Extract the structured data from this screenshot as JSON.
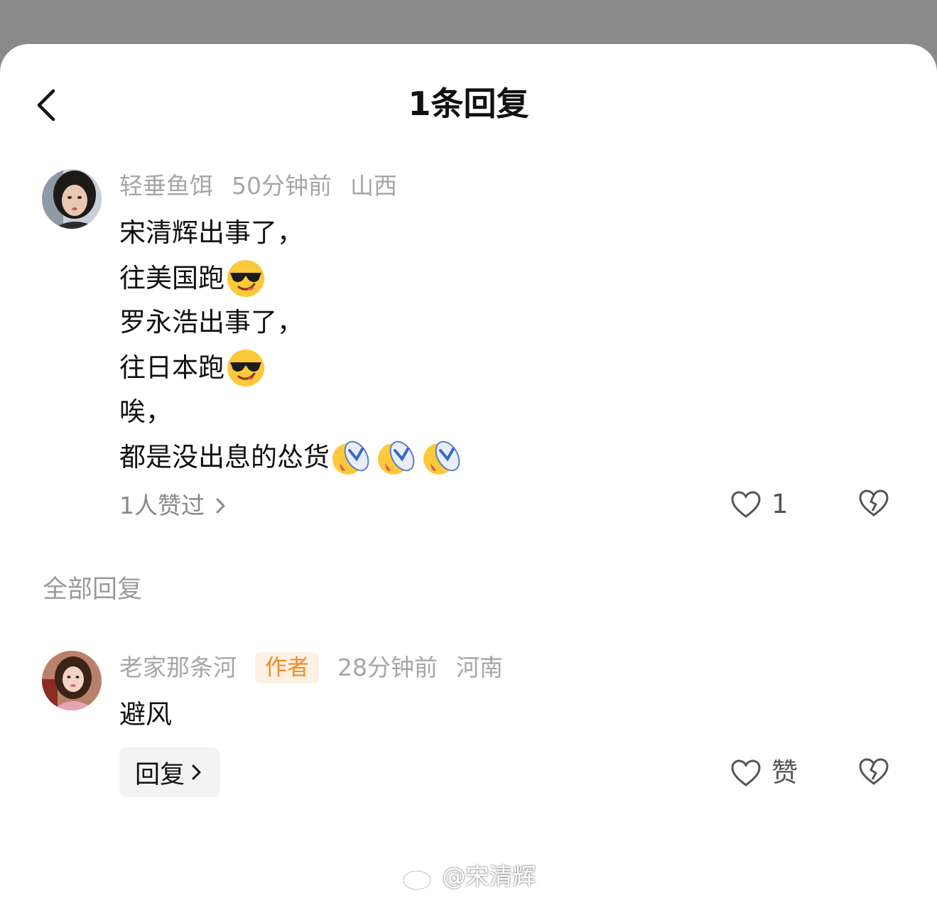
{
  "header": {
    "title": "1条回复"
  },
  "comment": {
    "username": "轻垂鱼饵",
    "time": "50分钟前",
    "location": "山西",
    "lines": [
      "宋清辉出事了，",
      "往美国跑",
      "罗永浩出事了，",
      "往日本跑",
      "唉，",
      "都是没出息的怂货"
    ],
    "emojis": {
      "line2": "cool-sunglasses-emoji",
      "line4": "cool-sunglasses-emoji",
      "line6": "crying-slipper-emoji"
    },
    "likes_text": "1人赞过",
    "like_count": "1"
  },
  "section": {
    "label": "全部回复"
  },
  "reply": {
    "username": "老家那条河",
    "badge": "作者",
    "time": "28分钟前",
    "location": "河南",
    "text": "避风",
    "reply_button": "回复",
    "like_label": "赞"
  },
  "watermark": {
    "text": "@宋清辉"
  },
  "colors": {
    "overlay": "#8a8a8a",
    "meta_gray": "#a6a6a6",
    "badge_bg": "#fdf1e4",
    "badge_text": "#f08a24"
  }
}
